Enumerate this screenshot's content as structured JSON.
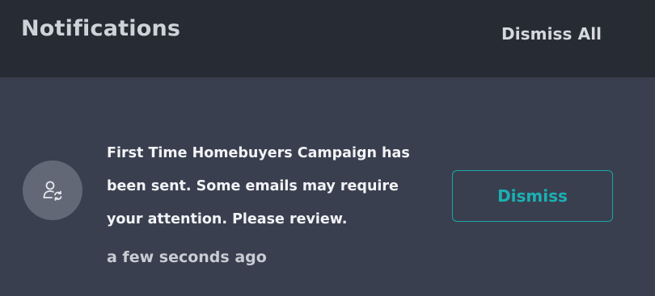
{
  "header": {
    "title": "Notifications",
    "dismiss_all_label": "Dismiss All"
  },
  "notifications": [
    {
      "icon": "user-sync-icon",
      "message": "First Time Homebuyers Campaign has been sent. Some emails may require your attention. Please review.",
      "timestamp": "a few seconds ago",
      "dismiss_label": "Dismiss"
    }
  ],
  "colors": {
    "header_bg": "#272b34",
    "panel_bg": "#3a3f50",
    "accent": "#1aa5a6",
    "avatar_bg": "#636877"
  }
}
